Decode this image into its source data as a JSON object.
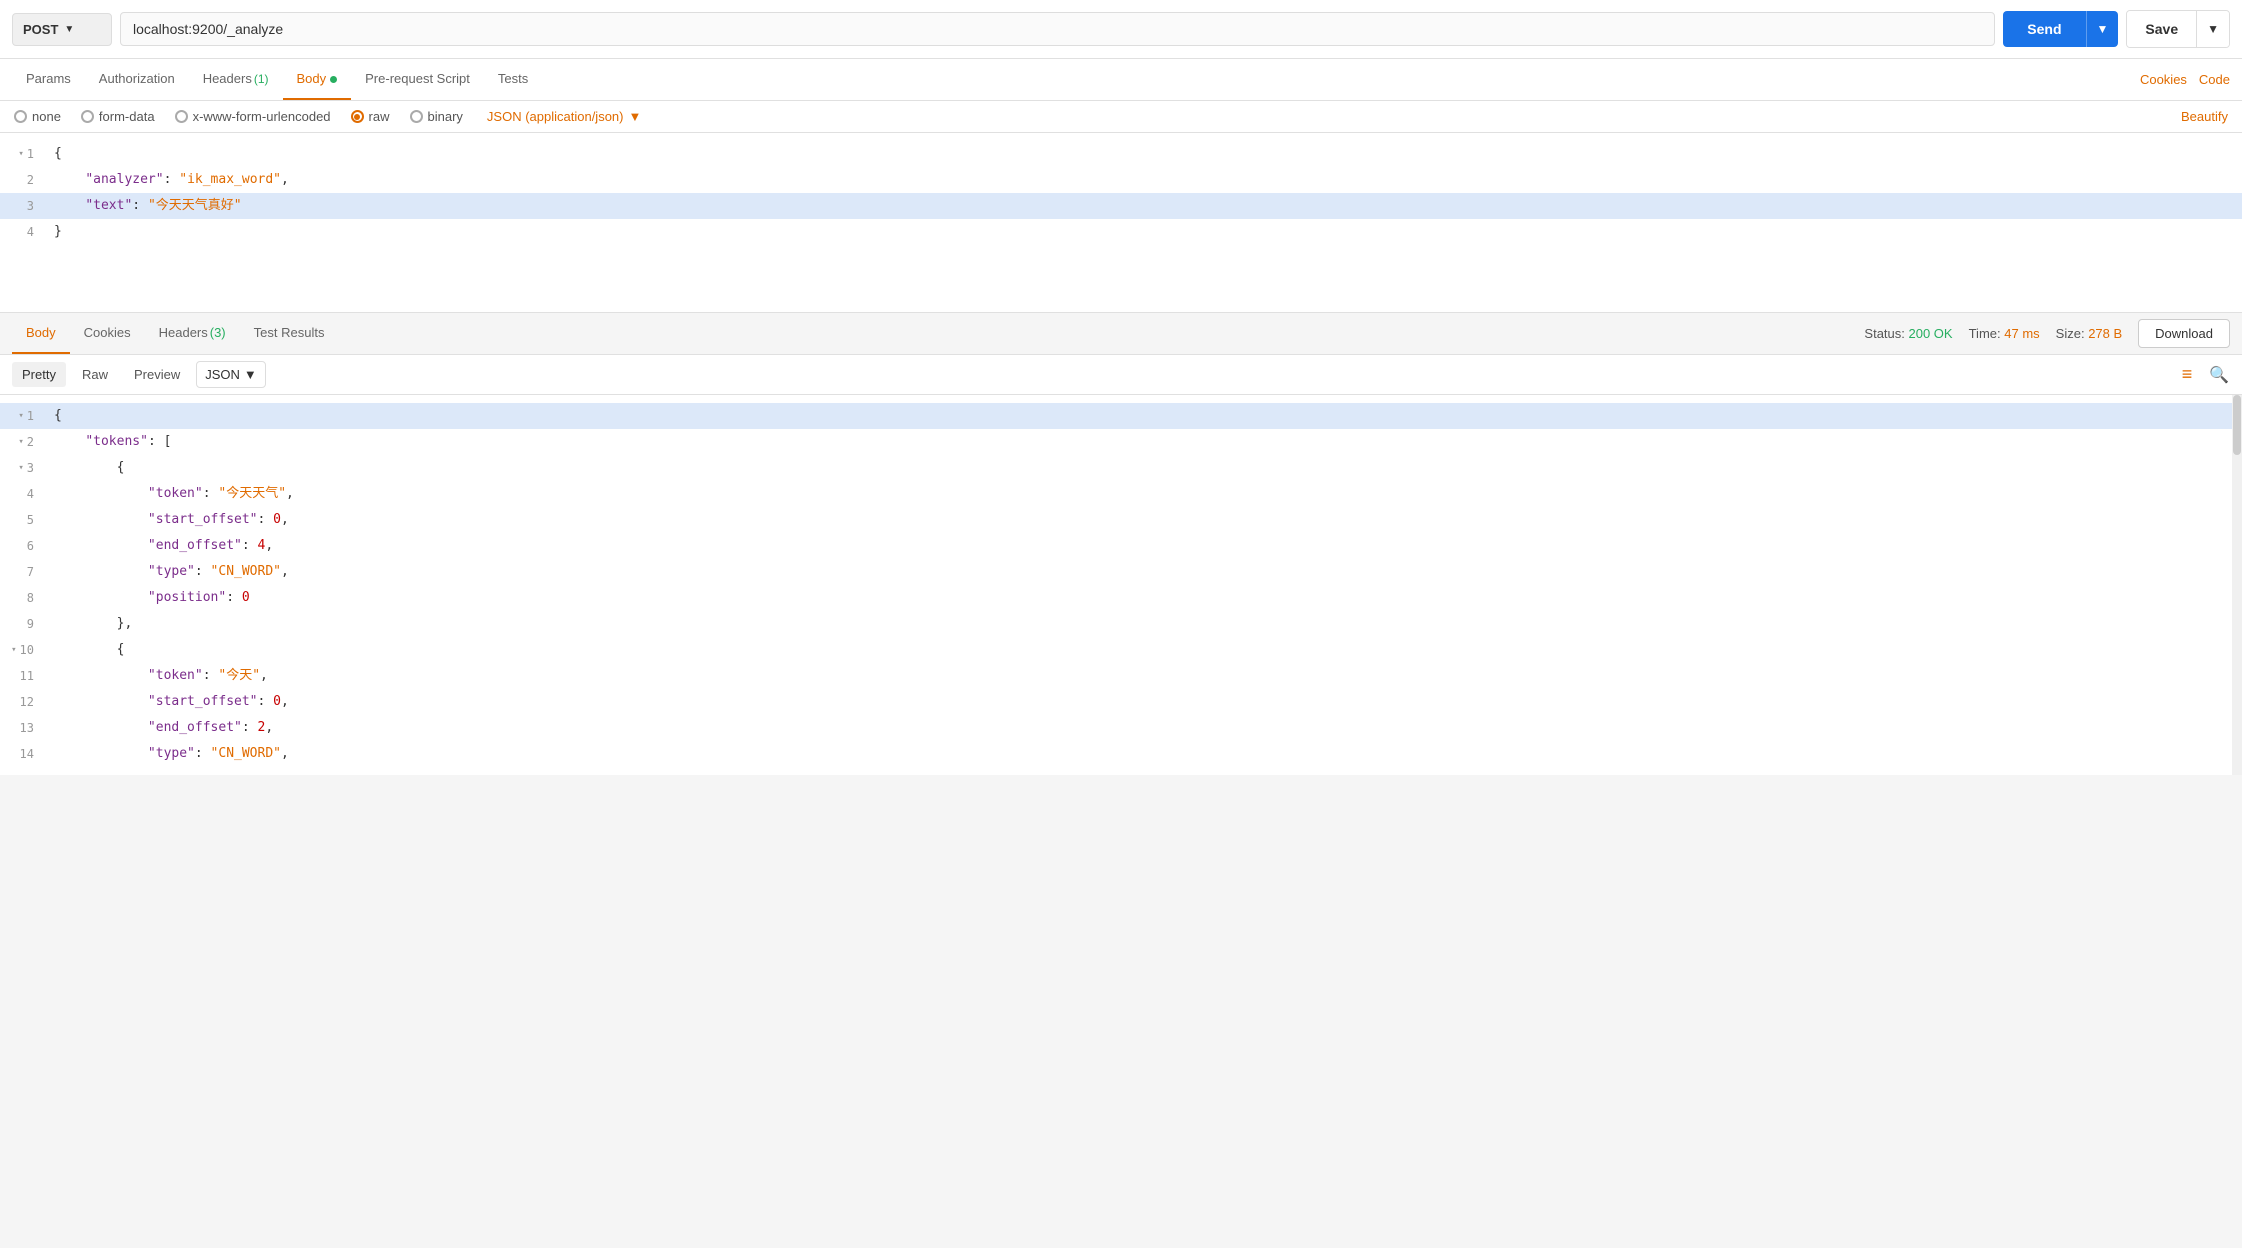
{
  "request": {
    "method": "POST",
    "url": "localhost:9200/_analyze",
    "send_label": "Send",
    "save_label": "Save"
  },
  "req_tabs": {
    "tabs": [
      {
        "id": "params",
        "label": "Params",
        "active": false,
        "badge": null,
        "dot": false
      },
      {
        "id": "authorization",
        "label": "Authorization",
        "active": false,
        "badge": null,
        "dot": false
      },
      {
        "id": "headers",
        "label": "Headers",
        "active": false,
        "badge": "(1)",
        "dot": false
      },
      {
        "id": "body",
        "label": "Body",
        "active": true,
        "badge": null,
        "dot": true
      },
      {
        "id": "pre-request",
        "label": "Pre-request Script",
        "active": false,
        "badge": null,
        "dot": false
      },
      {
        "id": "tests",
        "label": "Tests",
        "active": false,
        "badge": null,
        "dot": false
      }
    ],
    "cookies_label": "Cookies",
    "code_label": "Code"
  },
  "body_options": {
    "options": [
      {
        "id": "none",
        "label": "none",
        "active": false
      },
      {
        "id": "form-data",
        "label": "form-data",
        "active": false
      },
      {
        "id": "x-www-form-urlencoded",
        "label": "x-www-form-urlencoded",
        "active": false
      },
      {
        "id": "raw",
        "label": "raw",
        "active": true
      },
      {
        "id": "binary",
        "label": "binary",
        "active": false
      }
    ],
    "format": "JSON (application/json)",
    "beautify_label": "Beautify"
  },
  "request_body": {
    "lines": [
      {
        "num": 1,
        "toggle": true,
        "content": "{",
        "highlighted": false
      },
      {
        "num": 2,
        "toggle": false,
        "content": "\"analyzer\": \"ik_max_word\",",
        "highlighted": false
      },
      {
        "num": 3,
        "toggle": false,
        "content": "\"text\":     \"今天天气真好\"",
        "highlighted": true
      },
      {
        "num": 4,
        "toggle": false,
        "content": "}",
        "highlighted": false
      }
    ]
  },
  "response": {
    "tabs": [
      {
        "id": "body",
        "label": "Body",
        "active": true,
        "badge": null
      },
      {
        "id": "cookies",
        "label": "Cookies",
        "active": false,
        "badge": null
      },
      {
        "id": "headers",
        "label": "Headers",
        "active": false,
        "badge": "(3)"
      },
      {
        "id": "test-results",
        "label": "Test Results",
        "active": false,
        "badge": null
      }
    ],
    "status_label": "Status:",
    "status_val": "200 OK",
    "time_label": "Time:",
    "time_val": "47 ms",
    "size_label": "Size:",
    "size_val": "278 B",
    "download_label": "Download"
  },
  "response_format": {
    "views": [
      {
        "id": "pretty",
        "label": "Pretty",
        "active": true
      },
      {
        "id": "raw",
        "label": "Raw",
        "active": false
      },
      {
        "id": "preview",
        "label": "Preview",
        "active": false
      }
    ],
    "format": "JSON"
  },
  "response_body": {
    "lines": [
      {
        "num": 1,
        "toggle": true,
        "content_type": "open",
        "highlighted": true
      },
      {
        "num": 2,
        "toggle": true,
        "key": "\"tokens\"",
        "val": "[",
        "highlighted": false
      },
      {
        "num": 3,
        "toggle": true,
        "content": "{",
        "highlighted": false
      },
      {
        "num": 4,
        "toggle": false,
        "key": "\"token\"",
        "val": "\"今天天气\"",
        "comma": ",",
        "highlighted": false
      },
      {
        "num": 5,
        "toggle": false,
        "key": "\"start_offset\"",
        "val": "0",
        "comma": ",",
        "highlighted": false
      },
      {
        "num": 6,
        "toggle": false,
        "key": "\"end_offset\"",
        "val": "4",
        "comma": ",",
        "highlighted": false
      },
      {
        "num": 7,
        "toggle": false,
        "key": "\"type\"",
        "val": "\"CN_WORD\"",
        "comma": ",",
        "highlighted": false
      },
      {
        "num": 8,
        "toggle": false,
        "key": "\"position\"",
        "val": "0",
        "comma": "",
        "highlighted": false
      },
      {
        "num": 9,
        "toggle": false,
        "content": "},",
        "highlighted": false
      },
      {
        "num": 10,
        "toggle": true,
        "content": "{",
        "highlighted": false
      },
      {
        "num": 11,
        "toggle": false,
        "key": "\"token\"",
        "val": "\"今天\"",
        "comma": ",",
        "highlighted": false
      },
      {
        "num": 12,
        "toggle": false,
        "key": "\"start_offset\"",
        "val": "0",
        "comma": ",",
        "highlighted": false
      },
      {
        "num": 13,
        "toggle": false,
        "key": "\"end_offset\"",
        "val": "2",
        "comma": ",",
        "highlighted": false
      },
      {
        "num": 14,
        "toggle": false,
        "key": "\"type\"",
        "val": "\"CN_WORD\"",
        "comma": ",",
        "highlighted": false
      }
    ]
  }
}
